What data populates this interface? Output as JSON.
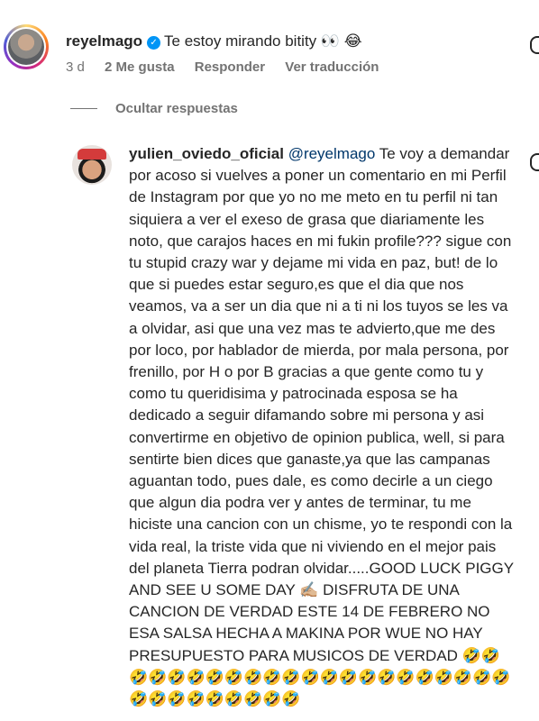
{
  "comment": {
    "username": "reyelmago",
    "text": "Te estoy mirando bitity 👀 😂",
    "time": "3 d",
    "likes": "2 Me gusta",
    "reply_label": "Responder",
    "translate_label": "Ver traducción"
  },
  "replies_toggle": "Ocultar respuestas",
  "reply": {
    "username": "yulien_oviedo_oficial",
    "mention": "@reyelmago",
    "text": " Te voy a demandar por acoso si vuelves a poner un comentario en mi Perfil de Instagram por que yo no me meto en tu perfil ni tan siquiera a ver el exeso de grasa que diariamente les noto, que carajos haces en mi fukin profile??? sigue con tu stupid crazy war y dejame mi vida en paz, but! de lo que si puedes estar seguro,es que el dia que nos veamos, va a ser un dia que ni a ti ni los tuyos se les va a olvidar, asi que una vez mas te advierto,que me des por loco, por hablador de mierda, por mala persona, por frenillo, por H o por B gracias a que gente como tu y como tu queridisima y patrocinada esposa se ha dedicado a seguir difamando sobre mi persona y asi convertirme en objetivo de opinion publica, well, si para sentirte bien dices que ganaste,ya que las campanas aguantan todo, pues dale, es como decirle a un ciego que algun dia podra ver y antes de terminar, tu me hiciste una cancion con un chisme, yo te respondi con la vida real, la triste vida que ni viviendo en el mejor pais del planeta Tierra podran olvidar.....GOOD LUCK PIGGY AND SEE U SOME DAY ✍🏼 DISFRUTA DE UNA CANCION DE VERDAD ESTE 14 DE FEBRERO NO ESA SALSA HECHA A MAKINA POR WUE NO HAY PRESUPUESTO PARA MUSICOS DE VERDAD 🤣🤣🤣🤣🤣🤣🤣🤣🤣🤣🤣🤣🤣🤣🤣🤣🤣🤣🤣🤣🤣🤣🤣🤣🤣🤣🤣🤣🤣🤣🤣"
  },
  "icons": {
    "verified": "verified-badge-icon",
    "like": "heart-outline-icon"
  }
}
